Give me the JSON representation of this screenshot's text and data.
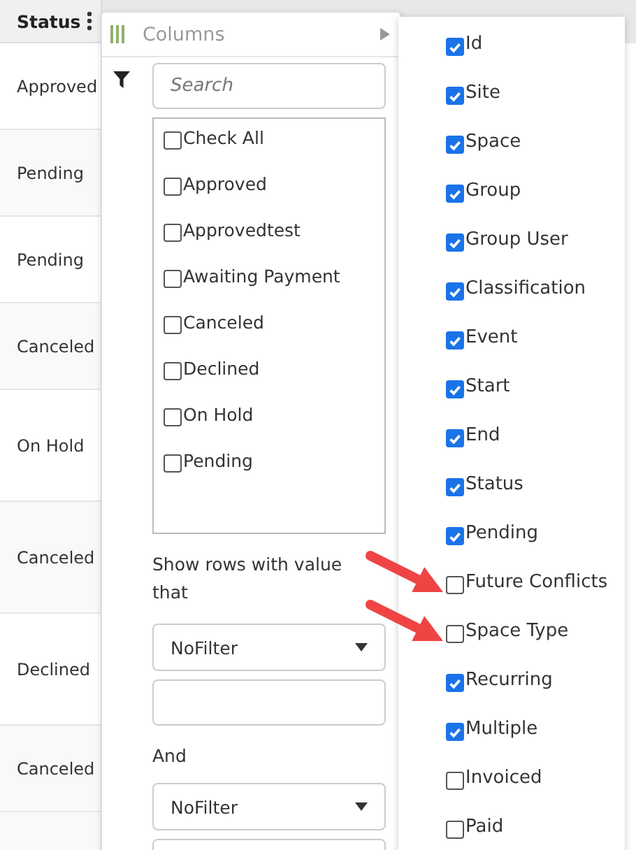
{
  "table": {
    "header": {
      "label": "Status"
    },
    "rows": [
      {
        "status": "Approved"
      },
      {
        "status": "Pending"
      },
      {
        "status": "Pending"
      },
      {
        "status": "Canceled"
      },
      {
        "status": "On Hold"
      },
      {
        "status": "Canceled"
      },
      {
        "status": "Declined"
      },
      {
        "status": "Canceled"
      }
    ]
  },
  "column_menu": {
    "title": "Columns",
    "search": {
      "placeholder": "Search"
    },
    "values": [
      {
        "label": "Check All",
        "checked": false
      },
      {
        "label": "Approved",
        "checked": false
      },
      {
        "label": "Approvedtest",
        "checked": false
      },
      {
        "label": "Awaiting Payment",
        "checked": false
      },
      {
        "label": "Canceled",
        "checked": false
      },
      {
        "label": "Declined",
        "checked": false
      },
      {
        "label": "On Hold",
        "checked": false
      },
      {
        "label": "Pending",
        "checked": false
      }
    ],
    "condition_label": "Show rows with value that",
    "condition_1": {
      "operator": "NoFilter"
    },
    "join_label": "And",
    "condition_2": {
      "operator": "NoFilter"
    }
  },
  "column_chooser": [
    {
      "label": "Id",
      "checked": true,
      "flagged": false
    },
    {
      "label": "Site",
      "checked": true,
      "flagged": false
    },
    {
      "label": "Space",
      "checked": true,
      "flagged": false
    },
    {
      "label": "Group",
      "checked": true,
      "flagged": false
    },
    {
      "label": "Group User",
      "checked": true,
      "flagged": false
    },
    {
      "label": "Classification",
      "checked": true,
      "flagged": false
    },
    {
      "label": "Event",
      "checked": true,
      "flagged": false
    },
    {
      "label": "Start",
      "checked": true,
      "flagged": false
    },
    {
      "label": "End",
      "checked": true,
      "flagged": false
    },
    {
      "label": "Status",
      "checked": true,
      "flagged": false
    },
    {
      "label": "Pending",
      "checked": true,
      "flagged": false
    },
    {
      "label": "Future Conflicts",
      "checked": false,
      "flagged": true
    },
    {
      "label": "Space Type",
      "checked": false,
      "flagged": true
    },
    {
      "label": "Recurring",
      "checked": true,
      "flagged": false
    },
    {
      "label": "Multiple",
      "checked": true,
      "flagged": false
    },
    {
      "label": "Invoiced",
      "checked": false,
      "flagged": false
    },
    {
      "label": "Paid",
      "checked": false,
      "flagged": false
    }
  ]
}
